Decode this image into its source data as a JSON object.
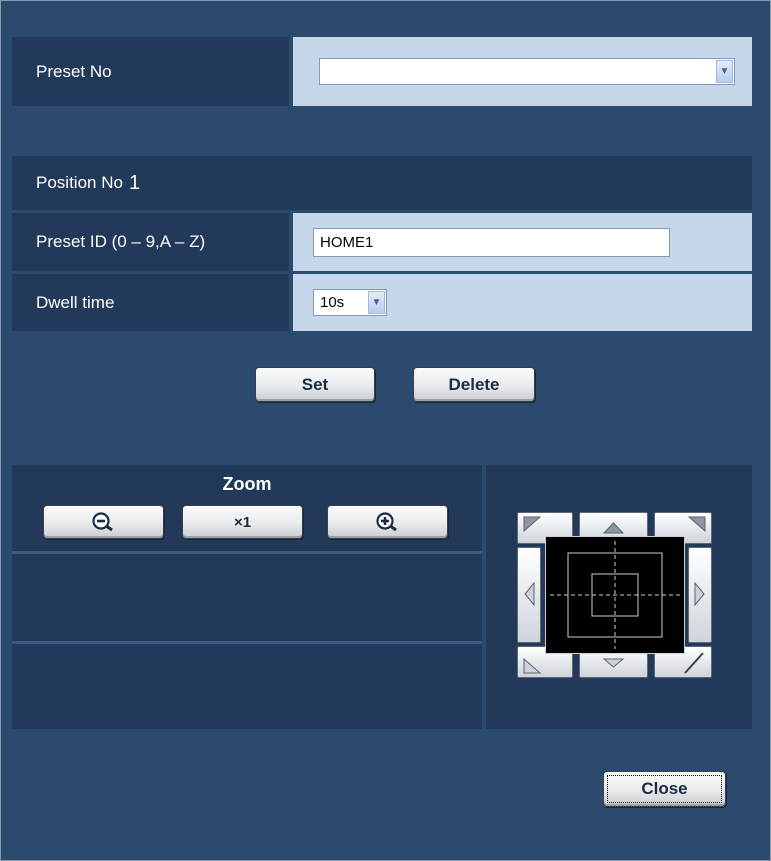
{
  "preset_no": {
    "label": "Preset No",
    "selected": ""
  },
  "position": {
    "label": "Position No",
    "number": "1"
  },
  "preset_id": {
    "label": "Preset ID (0 – 9,A – Z)",
    "value": "HOME1"
  },
  "dwell_time": {
    "label": "Dwell time",
    "selected": "10s"
  },
  "buttons": {
    "set": "Set",
    "delete": "Delete",
    "close": "Close"
  },
  "zoom": {
    "title": "Zoom",
    "zoom_out_icon": "zoom-out-icon",
    "reset_label": "×1",
    "zoom_in_icon": "zoom-in-icon"
  },
  "colors": {
    "panel": "#2c4a6e",
    "label_bg": "#22395a",
    "value_bg": "#c7d7ea"
  }
}
